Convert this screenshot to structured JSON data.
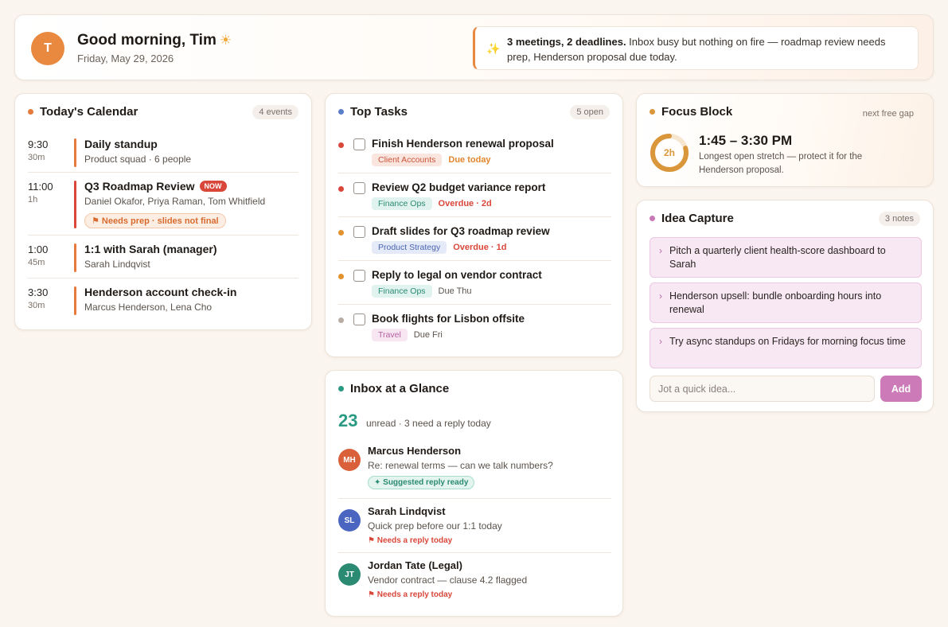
{
  "header": {
    "avatar_initial": "T",
    "greeting": "Good morning, Tim",
    "greeting_icon": "sun-icon",
    "date": "Friday, May 29, 2026",
    "summary_bold": "3 meetings, 2 deadlines.",
    "summary_rest": " Inbox busy but nothing on fire — roadmap review needs prep, Henderson proposal due today.",
    "summary_icon": "sparkle-icon"
  },
  "calendar": {
    "title": "Today's Calendar",
    "count": "4 events",
    "accent": "#e57a3c",
    "events": [
      {
        "time": "9:30",
        "duration": "30m",
        "title": "Daily standup",
        "people": "Product squad · 6 people"
      },
      {
        "time": "11:00",
        "duration": "1h",
        "title": "Q3 Roadmap Review",
        "badge": "NOW",
        "people": "Daniel Okafor, Priya Raman, Tom Whitfield",
        "note": "⚑ Needs prep · slides not final"
      },
      {
        "time": "1:00",
        "duration": "45m",
        "title": "1:1 with Sarah (manager)",
        "people": "Sarah Lindqvist"
      },
      {
        "time": "3:30",
        "duration": "30m",
        "title": "Henderson account check-in",
        "people": "Marcus Henderson, Lena Cho"
      }
    ]
  },
  "tasks": {
    "title": "Top Tasks",
    "count": "5 open",
    "accent": "#5b7ec9",
    "items": [
      {
        "title": "Finish Henderson renewal proposal",
        "tag": "Client Accounts",
        "due": "Due today",
        "dot": "#d9473a",
        "tag_bg": "#fbe6df",
        "tag_fg": "#c9533a",
        "due_color": "#e2862e"
      },
      {
        "title": "Review Q2 budget variance report",
        "tag": "Finance Ops",
        "due": "Overdue · 2d",
        "dot": "#d9473a",
        "tag_bg": "#e1f3ee",
        "tag_fg": "#2a8a72",
        "due_color": "#d9473a"
      },
      {
        "title": "Draft slides for Q3 roadmap review",
        "tag": "Product Strategy",
        "due": "Overdue · 1d",
        "dot": "#e2932e",
        "tag_bg": "#e4eaf8",
        "tag_fg": "#4a66b0",
        "due_color": "#d9473a"
      },
      {
        "title": "Reply to legal on vendor contract",
        "tag": "Finance Ops",
        "due": "Due Thu",
        "dot": "#e2932e",
        "tag_bg": "#e1f3ee",
        "tag_fg": "#2a8a72",
        "due_color": "#5b534c"
      },
      {
        "title": "Book flights for Lisbon offsite",
        "tag": "Travel",
        "due": "Due Fri",
        "dot": "#b8ada4",
        "tag_bg": "#f8e6f3",
        "tag_fg": "#b4609f",
        "due_color": "#5b534c"
      }
    ]
  },
  "inbox": {
    "title": "Inbox at a Glance",
    "accent": "#2a9a82",
    "unread": "23",
    "unread_text": "unread · 3 need a reply today",
    "messages": [
      {
        "initials": "MH",
        "avatar_color": "#d9603a",
        "from": "Marcus Henderson",
        "subject": "Re: renewal terms — can we talk numbers?",
        "suggest": "✦ Suggested reply ready"
      },
      {
        "initials": "SL",
        "avatar_color": "#4a66c0",
        "from": "Sarah Lindqvist",
        "subject": "Quick prep before our 1:1 today",
        "flag": "⚑ Needs a reply today"
      },
      {
        "initials": "JT",
        "avatar_color": "#2a8a72",
        "from": "Jordan Tate (Legal)",
        "subject": "Vendor contract — clause 4.2 flagged",
        "flag": "⚑ Needs a reply today"
      }
    ]
  },
  "focus": {
    "title": "Focus Block",
    "accent": "#d9963a",
    "note": "next free gap",
    "ring_label": "2h",
    "time": "1:45 – 3:30 PM",
    "description": "Longest open stretch — protect it for the Henderson proposal."
  },
  "ideas": {
    "title": "Idea Capture",
    "count": "3 notes",
    "accent": "#c978b6",
    "items": [
      "Pitch a quarterly client health-score dashboard to Sarah",
      "Henderson upsell: bundle onboarding hours into renewal",
      "Try async standups on Fridays for morning focus time"
    ],
    "input_placeholder": "Jot a quick idea...",
    "input_value": "",
    "add_label": "Add"
  }
}
